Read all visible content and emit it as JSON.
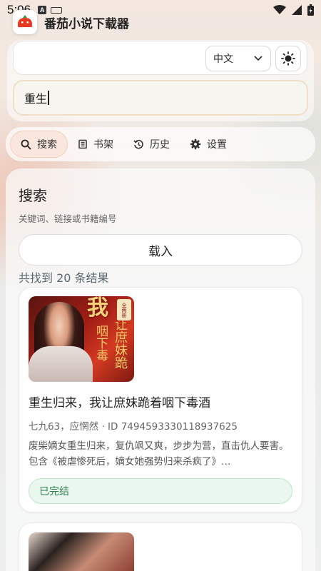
{
  "status_bar": {
    "time": "5:06",
    "a_icon": "A"
  },
  "app": {
    "title": "番茄小说下载器"
  },
  "top": {
    "url_value": "",
    "language": "中文",
    "search_value": "重生"
  },
  "nav": {
    "items": [
      {
        "label": "搜索",
        "icon": "search-icon",
        "active": true
      },
      {
        "label": "书架",
        "icon": "bookshelf-icon"
      },
      {
        "label": "历史",
        "icon": "history-icon"
      },
      {
        "label": "设置",
        "icon": "gear-icon"
      }
    ]
  },
  "search_section": {
    "title": "搜索",
    "subtitle": "关键词、链接或书籍编号",
    "load_button": "载入",
    "result_count": "共找到 20 条结果"
  },
  "results": [
    {
      "title": "重生归来，我让庶妹跪着咽下毒酒",
      "meta": "七九63，应惘然 · ID 7494593330118937625",
      "description": "废柴嫡女重生归来，复仇飒又爽，步步为营，直击仇人要害。包含《被虐惨死后，嫡女她强势归来杀疯了》…",
      "status": "已完结",
      "cover_text": {
        "big": "我",
        "col1": "让庶妹跪",
        "col2": "咽下毒",
        "side": "重生归来",
        "badge": "全两册"
      }
    }
  ],
  "colors": {
    "accent": "#fbe6dd",
    "status_green": "#2f7d4d",
    "status_bg": "#e9f7ef"
  }
}
